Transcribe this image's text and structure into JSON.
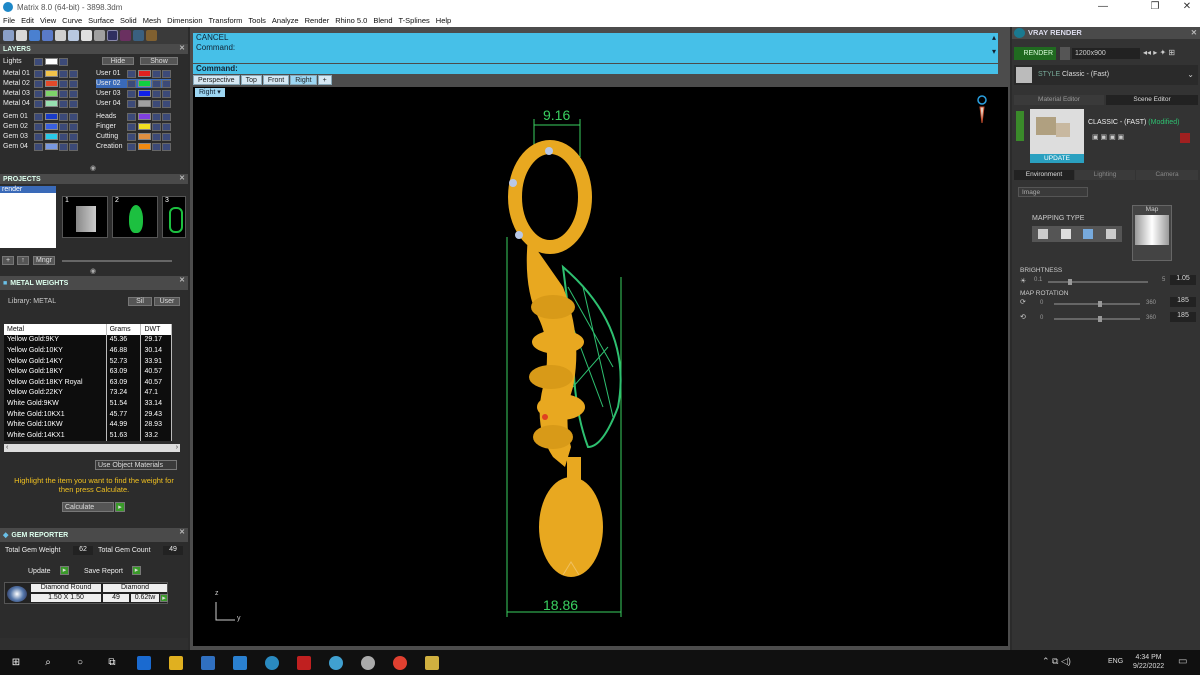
{
  "window": {
    "title": "Matrix 8.0 (64-bit) - 3898.3dm",
    "min": "—",
    "max": "❐",
    "close": "✕"
  },
  "menu": [
    "File",
    "Edit",
    "View",
    "Curve",
    "Surface",
    "Solid",
    "Mesh",
    "Dimension",
    "Transform",
    "Tools",
    "Analyze",
    "Render",
    "Rhino 5.0",
    "Blend",
    "T-Splines",
    "Help"
  ],
  "layers": {
    "title": "LAYERS",
    "lights": "Lights",
    "hide": "Hide",
    "show": "Show",
    "rows_left": [
      "Metal 01",
      "Metal 02",
      "Metal 03",
      "Metal 04",
      "Gem 01",
      "Gem 02",
      "Gem 03",
      "Gem 04"
    ],
    "rows_right": [
      "User 01",
      "User 02",
      "User 03",
      "User 04",
      "Heads",
      "Finger",
      "Cutting",
      "Creation"
    ],
    "colors_left": [
      "#f2c44a",
      "#e34a2a",
      "#7ed36a",
      "#98e0b0",
      "#1a3cc8",
      "#3a60e0",
      "#28c8e8",
      "#7898e0"
    ],
    "colors_right": [
      "#e02020",
      "#10d040",
      "#1020e8",
      "#a0a0a0",
      "#8040e0",
      "#f0e020",
      "#e09040",
      "#f08a10"
    ]
  },
  "projects": {
    "title": "PROJECTS",
    "item": "render",
    "thumbs": [
      "1",
      "2",
      "3"
    ],
    "mngr": "Mngr"
  },
  "metal_weights": {
    "title": "METAL WEIGHTS",
    "library": "Library: METAL",
    "opt1": "Sil",
    "opt2": "User",
    "headers": [
      "Metal",
      "Grams",
      "DWT"
    ],
    "rows": [
      [
        "Yellow Gold:9KY",
        "45.36",
        "29.17"
      ],
      [
        "Yellow Gold:10KY",
        "46.88",
        "30.14"
      ],
      [
        "Yellow Gold:14KY",
        "52.73",
        "33.91"
      ],
      [
        "Yellow Gold:18KY",
        "63.09",
        "40.57"
      ],
      [
        "Yellow Gold:18KY Royal",
        "63.09",
        "40.57"
      ],
      [
        "Yellow Gold:22KY",
        "73.24",
        "47.1"
      ],
      [
        "White Gold:9KW",
        "51.54",
        "33.14"
      ],
      [
        "White Gold:10KX1",
        "45.77",
        "29.43"
      ],
      [
        "White Gold:10KW",
        "44.99",
        "28.93"
      ],
      [
        "White Gold:14KX1",
        "51.63",
        "33.2"
      ]
    ],
    "use_object": "Use Object Materials",
    "hint": "Highlight the item you want to find the weight for then press Calculate.",
    "calculate": "Calculate"
  },
  "gem_reporter": {
    "title": "GEM REPORTER",
    "total_weight_label": "Total Gem Weight",
    "total_weight": "62",
    "total_count_label": "Total Gem Count",
    "total_count": "49",
    "update": "Update",
    "save": "Save Report",
    "shape": "Diamond Round",
    "material": "Diamond",
    "size": "1.50 X 1.50",
    "qty": "49",
    "ctw": "0.62tw"
  },
  "command": {
    "line1": "CANCEL",
    "line2": "Command:",
    "line3": "Command:"
  },
  "viewtabs": [
    "Perspective",
    "Top",
    "Front",
    "Right",
    "+"
  ],
  "viewport": {
    "label": "Right",
    "dim_top": "9.16",
    "dim_bottom": "18.86",
    "axis_z": "z",
    "axis_y": "y"
  },
  "vray": {
    "title": "VRAY RENDER",
    "render": "RENDER",
    "size": "1200x900",
    "style": "STYLE",
    "style_value": "Classic - (Fast)",
    "tabs": [
      "Material Editor",
      "Scene Editor"
    ],
    "preset": "CLASSIC - (FAST)",
    "modified": "(Modified)",
    "update": "UPDATE",
    "env_tabs": [
      "Environment",
      "Lighting",
      "Camera"
    ],
    "image": "Image",
    "mapping": "MAPPING TYPE",
    "map": "Map",
    "brightness": "BRIGHTNESS",
    "b_min": "0.1",
    "b_max": "5",
    "b_val": "1.05",
    "b_level": 0.2,
    "rotation": "MAP ROTATION",
    "r_min": "0",
    "r_max": "360",
    "r1": "185",
    "r2": "185",
    "r_level": 0.51
  },
  "taskbar": {
    "time": "4:34 PM",
    "date": "9/22/2022",
    "lang": "ENG"
  }
}
